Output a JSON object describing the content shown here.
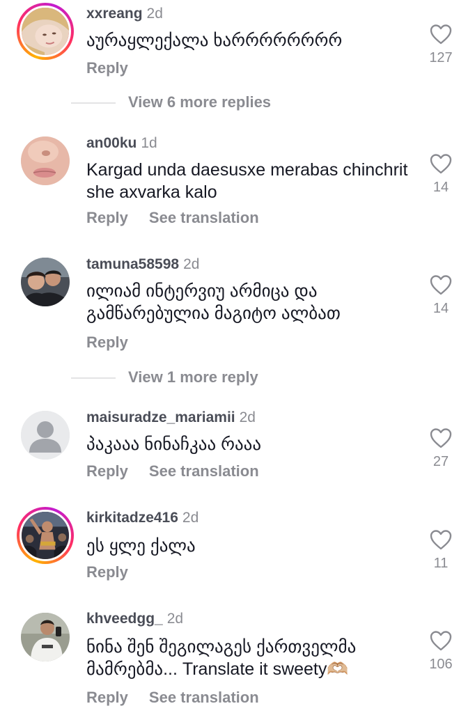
{
  "common": {
    "reply_label": "Reply",
    "translate_label": "See translation"
  },
  "comments": [
    {
      "username": "xxreang",
      "time": "2d",
      "text": "აურაყლექალა ხარრრრრრრრ",
      "likes": "127"
    },
    {
      "username": "an00ku",
      "time": "1d",
      "text": "Kargad unda daesusxe merabas chinchrit she axvarka kalo",
      "likes": "14"
    },
    {
      "username": "tamuna58598",
      "time": "2d",
      "text": "ილიამ ინტერვიუ არმიცა და გამწარებულია მაგიტო ალბათ",
      "likes": "14"
    },
    {
      "username": "maisuradze_mariamii",
      "time": "2d",
      "text": "პაკააა ნინაჩკაა რააა",
      "likes": "27"
    },
    {
      "username": "kirkitadze416",
      "time": "2d",
      "text": "ეს ყლე ქალა",
      "likes": "11"
    },
    {
      "username": "khveedgg_",
      "time": "2d",
      "text": "ნინა შენ შეგილაგეს ქართველმა მამრებმა... Translate it sweety🫶🏼",
      "likes": "106"
    }
  ],
  "view_more": [
    {
      "label": "View 6 more replies"
    },
    {
      "label": "View 1 more reply"
    }
  ]
}
